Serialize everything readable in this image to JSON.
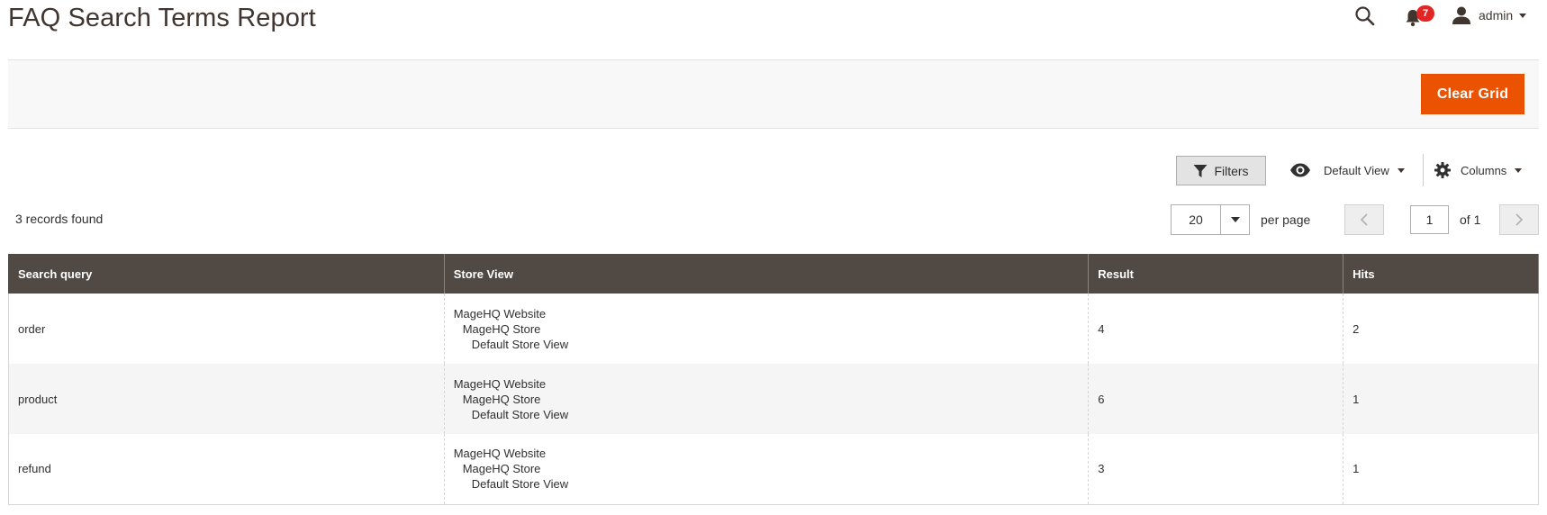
{
  "header": {
    "title": "FAQ Search Terms Report",
    "notifications_count": "7",
    "user_name": "admin"
  },
  "action_bar": {
    "clear_grid_label": "Clear Grid"
  },
  "toolbar": {
    "filters_label": "Filters",
    "view_label": "Default View",
    "columns_label": "Columns"
  },
  "pager": {
    "records_found": "3 records found",
    "per_page_value": "20",
    "per_page_label": "per page",
    "current_page": "1",
    "of_label": "of 1"
  },
  "grid": {
    "columns": [
      "Search query",
      "Store View",
      "Result",
      "Hits"
    ],
    "rows": [
      {
        "query": "order",
        "store_view": [
          "MageHQ Website",
          "MageHQ Store",
          "Default Store View"
        ],
        "result": "4",
        "hits": "2"
      },
      {
        "query": "product",
        "store_view": [
          "MageHQ Website",
          "MageHQ Store",
          "Default Store View"
        ],
        "result": "6",
        "hits": "1"
      },
      {
        "query": "refund",
        "store_view": [
          "MageHQ Website",
          "MageHQ Store",
          "Default Store View"
        ],
        "result": "3",
        "hits": "1"
      }
    ]
  },
  "colors": {
    "accent": "#eb5202",
    "table_header": "#514943",
    "badge": "#e22626"
  },
  "icons": [
    "search-icon",
    "bell-icon",
    "user-icon",
    "filter-icon",
    "eye-icon",
    "gear-icon",
    "chevron-left-icon",
    "chevron-right-icon"
  ]
}
